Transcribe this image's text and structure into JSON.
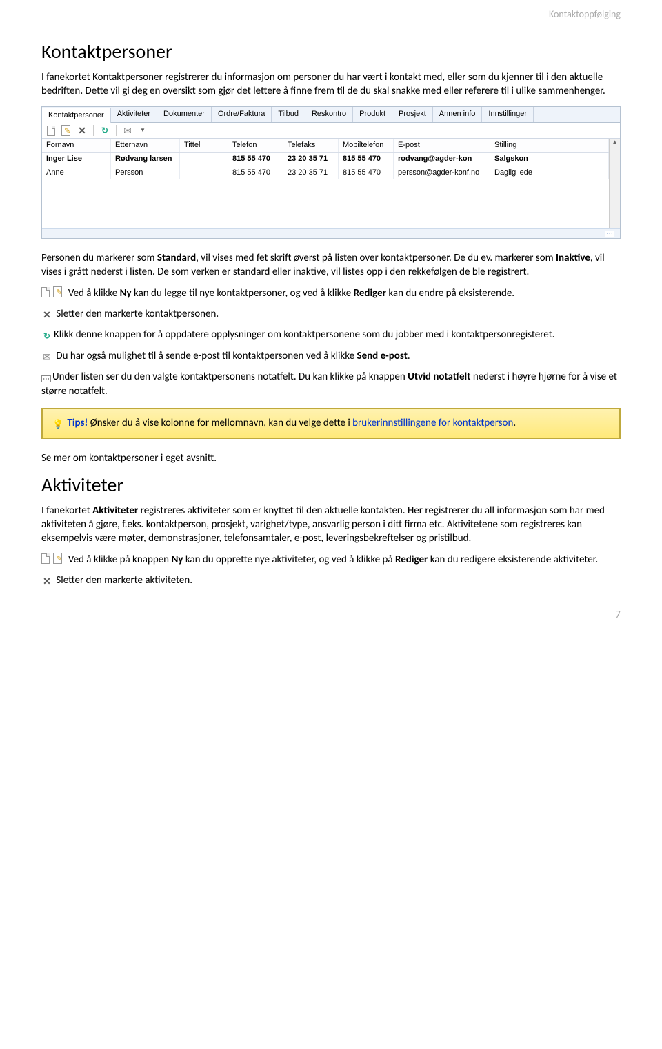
{
  "header": "Kontaktoppfølging",
  "h1a": "Kontaktpersoner",
  "p1": "I fanekortet Kontaktpersoner registrerer du informasjon om personer du har vært i kontakt med, eller som du kjenner til i den aktuelle bedriften. Dette vil gi deg en oversikt som gjør det lettere å finne frem til de du skal snakke med eller referere til i ulike sammenhenger.",
  "tabs": [
    "Kontaktpersoner",
    "Aktiviteter",
    "Dokumenter",
    "Ordre/Faktura",
    "Tilbud",
    "Reskontro",
    "Produkt",
    "Prosjekt",
    "Annen info",
    "Innstillinger"
  ],
  "columns": [
    "Fornavn",
    "Etternavn",
    "Tittel",
    "Telefon",
    "Telefaks",
    "Mobiltelefon",
    "E-post",
    "Stilling"
  ],
  "rows": [
    {
      "bold": true,
      "cells": [
        "Inger Lise",
        "Rødvang larsen",
        "",
        "815 55 470",
        "23 20 35 71",
        "815 55 470",
        "rodvang@agder-kon",
        "Salgskon"
      ]
    },
    {
      "bold": false,
      "cells": [
        "Anne",
        "Persson",
        "",
        "815 55 470",
        "23 20 35 71",
        "815 55 470",
        "persson@agder-konf.no",
        "Daglig lede"
      ]
    }
  ],
  "p2a": "Personen du markerer som ",
  "p2b": "Standard",
  "p2c": ", vil vises med fet skrift øverst på listen over kontaktpersoner. De du ev. markerer som ",
  "p2d": "Inaktive",
  "p2e": ", vil vises i grått nederst i listen. De som verken er standard eller inaktive, vil listes opp i den rekkefølgen de ble registrert.",
  "p3a": " Ved å klikke ",
  "p3b": "Ny",
  "p3c": " kan du legge til nye kontaktpersoner, og ved å klikke ",
  "p3d": "Rediger",
  "p3e": " kan du endre på eksisterende.",
  "p4": "Sletter den markerte kontaktpersonen.",
  "p5": "Klikk denne knappen for å oppdatere opplysninger om kontaktpersonene som du jobber med i kontaktpersonregisteret.",
  "p6a": " Du har også mulighet til å sende e-post til kontaktpersonen ved å klikke ",
  "p6b": "Send e-post",
  "p6c": ".",
  "p7a": "Under listen ser du den valgte kontaktpersonens notatfelt. Du kan klikke på knappen ",
  "p7b": "Utvid notatfelt",
  "p7c": " nederst i høyre hjørne for å vise et større notatfelt.",
  "tip_lead": "Tips!",
  "tip_text": " Ønsker du å vise kolonne for mellomnavn, kan du velge dette i ",
  "tip_link": "brukerinnstillingene for kontaktperson",
  "tip_tail": ".",
  "p8": "Se mer om kontaktpersoner i eget avsnitt.",
  "h1b": "Aktiviteter",
  "p9a": "I fanekortet ",
  "p9b": "Aktiviteter",
  "p9c": " registreres aktiviteter som er knyttet til den aktuelle kontakten. Her registrerer du all informasjon som har med aktiviteten å gjøre, f.eks. kontaktperson, prosjekt, varighet/type, ansvarlig person i ditt firma etc. Aktivitetene som registreres kan eksempelvis være møter, demonstrasjoner, telefonsamtaler, e-post, leveringsbekreftelser og pristilbud.",
  "p10a": " Ved å klikke på knappen ",
  "p10b": "Ny",
  "p10c": " kan du opprette nye aktiviteter, og ved å klikke på ",
  "p10d": "Rediger",
  "p10e": " kan du redigere eksisterende aktiviteter.",
  "p11": " Sletter den markerte aktiviteten.",
  "page": "7"
}
